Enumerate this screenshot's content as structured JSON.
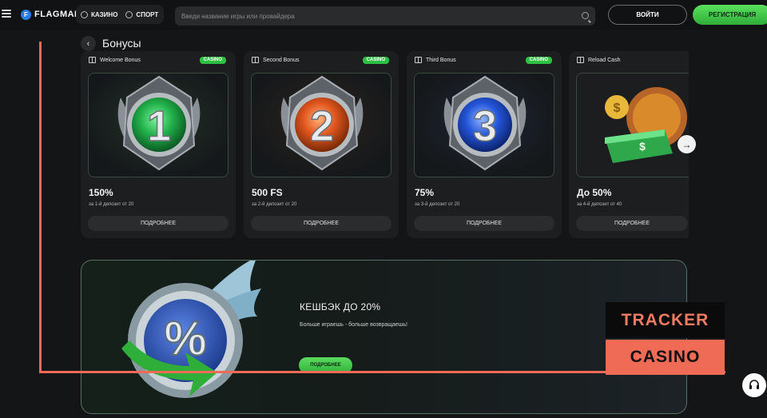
{
  "header": {
    "logo_mark": "F",
    "logo_text": "FLAGMAN",
    "nav": [
      {
        "label": "КАЗИНО",
        "icon": "casino-chip-icon"
      },
      {
        "label": "СПОРТ",
        "icon": "sport-ball-icon"
      }
    ],
    "search_placeholder": "Введи название игры или провайдера",
    "login_label": "ВОЙТИ",
    "register_label": "РЕГИСТРАЦИЯ"
  },
  "bonuses": {
    "title": "Бонусы",
    "cards": [
      {
        "name": "Welcome Bonus",
        "badge": "CASINO",
        "value": "150%",
        "desc": "за 1-й депозит от 20",
        "button": "ПОДРОБНЕЕ",
        "medal_number": "1",
        "medal_color": "#22b04a"
      },
      {
        "name": "Second Bonus",
        "badge": "CASINO",
        "value": "500 FS",
        "desc": "за 2-й депозит от 20",
        "button": "ПОДРОБНЕЕ",
        "medal_number": "2",
        "medal_color": "#e0561e"
      },
      {
        "name": "Third Bonus",
        "badge": "CASINO",
        "value": "75%",
        "desc": "за 3-й депозит от 20",
        "button": "ПОДРОБНЕЕ",
        "medal_number": "3",
        "medal_color": "#2455d8"
      },
      {
        "name": "Reload Cash",
        "badge": "",
        "value": "До 50%",
        "desc": "за 4-й депозит от 40",
        "button": "ПОДРОБНЕЕ",
        "medal_number": "",
        "medal_color": "#d98a2a"
      }
    ]
  },
  "cashback": {
    "title": "КЕШБЭК ДО 20%",
    "subtitle": "Больше играешь - больше возвращаешь!",
    "button": "ПОДРОБНЕЕ",
    "symbol": "%"
  },
  "watermark": {
    "line1": "TRACKER",
    "line2": "CASINO"
  },
  "colors": {
    "accent_green": "#3cc64a",
    "watermark_red": "#ef6b55"
  }
}
